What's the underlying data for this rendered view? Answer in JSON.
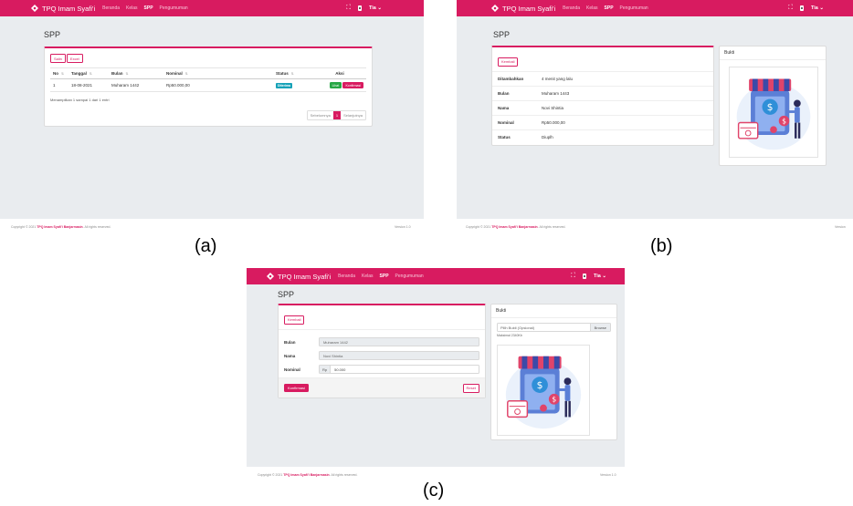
{
  "common": {
    "brand": "TPQ Imam Syafi'i",
    "nav": [
      "Beranda",
      "Kelas",
      "SPP",
      "Pengumuman"
    ],
    "user": "Tia",
    "page_title": "SPP",
    "footer_prefix": "Copyright © 2021 ",
    "footer_link": "TPQ Imam Syafi'i Banjarmasin",
    "footer_suffix": ". All rights reserved.",
    "version": "Version 1.0",
    "version_b": "Version"
  },
  "panel_a": {
    "caption": "(a)",
    "btn_salin": "Salin",
    "btn_excel": "Excel",
    "columns": [
      "No",
      "Tanggal",
      "Bulan",
      "Nominal",
      "Status",
      "Aksi"
    ],
    "rows": [
      {
        "no": "1",
        "tanggal": "18-08-2021",
        "bulan": "Muharam 1442",
        "nominal": "Rp50.000,00",
        "status": "Diterima",
        "aksi_lihat": "Lihat",
        "aksi_konfirmasi": "Konfirmasi"
      }
    ],
    "info": "Menampilkan 1 sampai 1 dari 1 entri",
    "pager": {
      "prev": "Sebelumnya",
      "page": "1",
      "next": "Selanjutnya"
    }
  },
  "panel_b": {
    "caption": "(b)",
    "btn_kembali": "Kembali",
    "bukti_title": "Bukti",
    "details": [
      {
        "label": "Ditambahkan",
        "value": "4 menit yang lalu"
      },
      {
        "label": "Bulan",
        "value": "Muharam 1443"
      },
      {
        "label": "Nama",
        "value": "Novi Shintia"
      },
      {
        "label": "Nominal",
        "value": "Rp50.000,00"
      },
      {
        "label": "Status",
        "value": "Diuplh"
      }
    ]
  },
  "panel_c": {
    "caption": "(c)",
    "btn_kembali": "Kembali",
    "bulan_label": "Bulan",
    "bulan_value": "Muharam 1442",
    "nama_label": "Nama",
    "nama_value": "Novi Shintia",
    "nominal_label": "Nominal",
    "nominal_prefix": "Rp",
    "nominal_value": "50.000",
    "btn_konfirmasi": "Konfirmasi",
    "btn_reset": "Reset",
    "bukti_title": "Bukti",
    "file_placeholder": "Pilih Bukti (Opsional)",
    "file_browse": "Browse",
    "file_hint": "Maksimal 2340Kb"
  },
  "colors": {
    "primary": "#d81b60",
    "success": "#28a745",
    "info": "#17a2b8",
    "background": "#e9ecef"
  }
}
